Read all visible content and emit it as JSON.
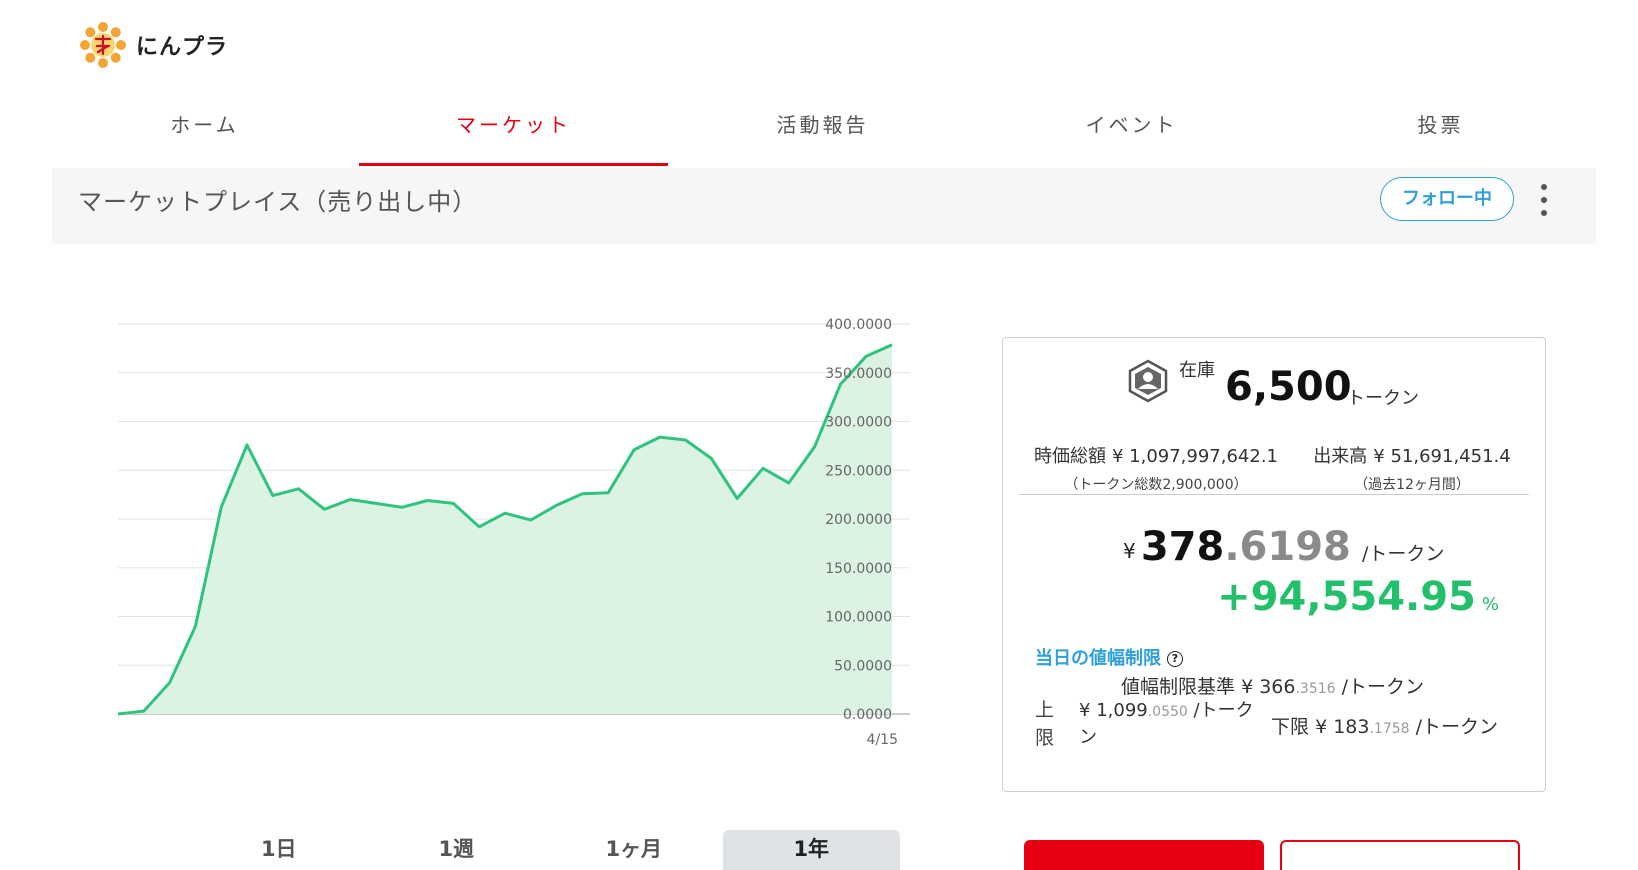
{
  "app": {
    "name": "にんプラ"
  },
  "nav": {
    "tabs": [
      {
        "label": "ホーム"
      },
      {
        "label": "マーケット"
      },
      {
        "label": "活動報告"
      },
      {
        "label": "イベント"
      },
      {
        "label": "投票"
      }
    ],
    "active": "マーケット"
  },
  "subheader": {
    "title": "マーケットプレイス（売り出し中）",
    "follow_label": "フォロー中"
  },
  "range_tabs": [
    {
      "label": "1日"
    },
    {
      "label": "1週"
    },
    {
      "label": "1ヶ月"
    },
    {
      "label": "1年"
    }
  ],
  "range_active": "1年",
  "info": {
    "inventory_label": "在庫",
    "inventory_value": "6,500",
    "inventory_unit": "トークン",
    "market_cap_label": "時価総額",
    "market_cap_value": "¥ 1,097,997,642.1",
    "market_cap_note": "（トークン総数2,900,000）",
    "volume_label": "出来高",
    "volume_value": "¥ 51,691,451.4",
    "volume_note": "（過去12ヶ月間）",
    "price_currency": "¥",
    "price_int": "378",
    "price_dec": ".6198",
    "price_unit": "/トークン",
    "change_value": "+94,554.95",
    "change_unit": "%",
    "limit_title": "当日の値幅制限",
    "limit_base_label": "値幅制限基準",
    "limit_base_currency": "¥",
    "limit_base_int": "366",
    "limit_base_dec": ".3516",
    "limit_base_unit": "/トークン",
    "upper_label": "上限",
    "upper_currency": "¥",
    "upper_int": "1,099",
    "upper_dec": ".0550",
    "upper_unit": "/トークン",
    "lower_label": "下限",
    "lower_currency": "¥",
    "lower_int": "183",
    "lower_dec": ".1758",
    "lower_unit": "/トークン"
  },
  "colors": {
    "accent": "#e60012",
    "link": "#2e9fd9",
    "positive": "#22c06b",
    "line": "#2ec47d",
    "area": "#dcf3e4"
  },
  "chart_data": {
    "type": "area",
    "x_tick_labels": [
      "4/15"
    ],
    "y_ticks": [
      "0.0000",
      "50.0000",
      "100.0000",
      "150.0000",
      "200.0000",
      "250.0000",
      "300.0000",
      "350.0000",
      "400.0000"
    ],
    "ylim": [
      0,
      400
    ],
    "grid": true,
    "y_axis_position": "right",
    "values": [
      0,
      3,
      32,
      90,
      212,
      276,
      224,
      231,
      210,
      220,
      216,
      212,
      219,
      216,
      192,
      206,
      199,
      214,
      226,
      227,
      271,
      284,
      281,
      262,
      221,
      252,
      237,
      274,
      338,
      367,
      378.6198
    ]
  }
}
